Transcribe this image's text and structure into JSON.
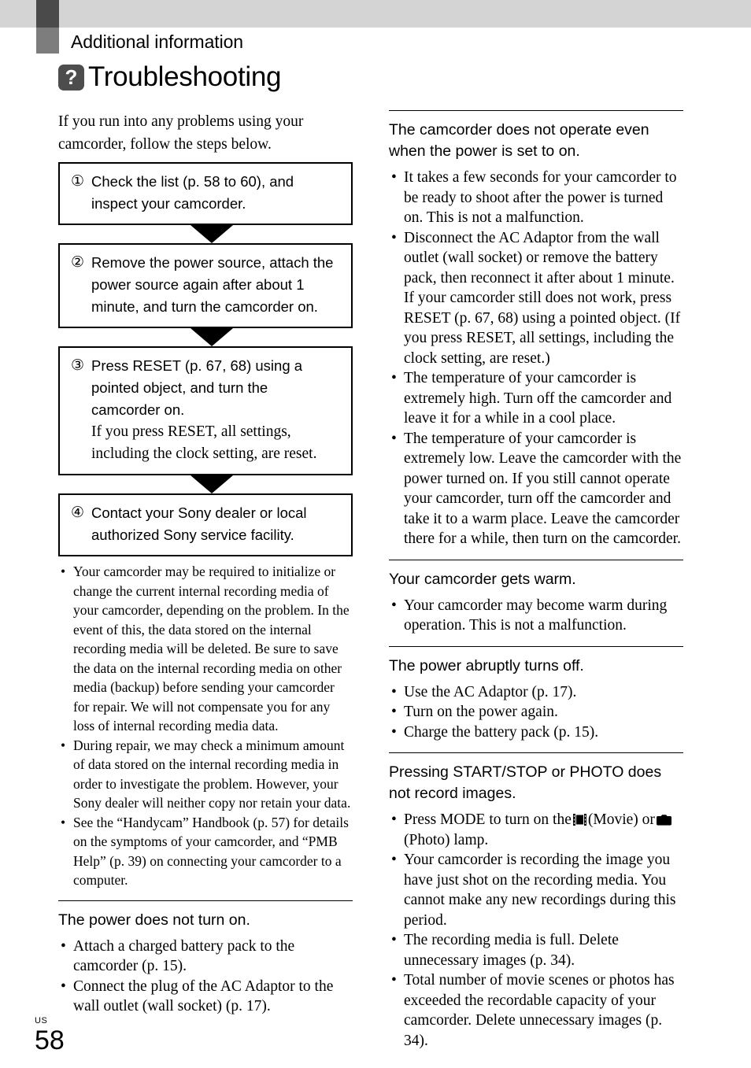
{
  "header": {
    "chapter": "Additional information",
    "section_title": "Troubleshooting",
    "badge_glyph": "?",
    "bar_color": "#d4d4d4",
    "tab_dark_color": "#4a4a4a",
    "tab_mid_color": "#7d7d7d",
    "badge_color": "#4d4d4d"
  },
  "left": {
    "intro": "If you run into any problems using your camcorder, follow the steps below.",
    "flow": [
      {
        "num": "①",
        "text": "Check the list (p. 58 to 60), and inspect your camcorder.",
        "sub": ""
      },
      {
        "num": "②",
        "text": "Remove the power source, attach the power source again after about 1 minute, and turn the camcorder on.",
        "sub": ""
      },
      {
        "num": "③",
        "text": "Press RESET (p. 67, 68) using a pointed object, and turn the camcorder on.",
        "sub": "If you press RESET, all settings, including the clock setting, are reset."
      },
      {
        "num": "④",
        "text": "Contact your Sony dealer or local authorized Sony service facility.",
        "sub": ""
      }
    ],
    "notes": [
      "Your camcorder may be required to initialize or change the current internal recording media of your camcorder, depending on the problem. In the event of this, the data stored on the internal recording media will be deleted. Be sure to save the data on the internal recording media on other media (backup) before sending your camcorder for repair. We will not compensate you for any loss of internal recording media data.",
      "During repair, we may check a minimum amount of data stored on the internal recording media in order to investigate the problem. However, your Sony dealer will neither copy nor retain your data.",
      "See the “Handycam” Handbook (p. 57) for details on the symptoms of your camcorder, and “PMB Help” (p. 39) on connecting your camcorder to a computer."
    ],
    "section": {
      "heading": "The power does not turn on.",
      "items": [
        "Attach a charged battery pack to the camcorder (p. 15).",
        "Connect the plug of the AC Adaptor to the wall outlet (wall socket) (p. 17)."
      ]
    }
  },
  "right": {
    "sections": [
      {
        "heading": "The camcorder does not operate even when the power is set to on.",
        "items": [
          "It takes a few seconds for your camcorder to be ready to shoot after the power is turned on. This is not a malfunction.",
          "Disconnect the AC Adaptor from the wall outlet (wall socket) or remove the battery pack, then reconnect it after about 1 minute. If your camcorder still does not work, press RESET (p. 67, 68) using a pointed object. (If you press RESET, all settings, including the clock setting, are reset.)",
          "The temperature of your camcorder is extremely high. Turn off the camcorder and leave it for a while in a cool place.",
          "The temperature of your camcorder is extremely low. Leave the camcorder with the power turned on. If you still cannot operate your camcorder, turn off the camcorder and take it to a warm place. Leave the camcorder there for a while, then turn on the camcorder."
        ]
      },
      {
        "heading": "Your camcorder gets warm.",
        "items": [
          "Your camcorder may become warm during operation. This is not a malfunction."
        ]
      },
      {
        "heading": "The power abruptly turns off.",
        "items": [
          "Use the AC Adaptor (p. 17).",
          "Turn on the power again.",
          "Charge the battery pack (p. 15)."
        ]
      },
      {
        "heading": "Pressing START/STOP or PHOTO does not record images.",
        "items": [
          "Your camcorder is recording the image you have just shot on the recording media. You cannot make any new recordings during this period.",
          "The recording media is full. Delete unnecessary images (p. 34).",
          "Total number of movie scenes or photos has exceeded the recordable capacity of your camcorder. Delete unnecessary images (p. 34)."
        ],
        "mode_item": {
          "before": "Press MODE to turn on the",
          "middle": "(Movie) or",
          "after": "(Photo) lamp.",
          "movie_icon": "movie-film-icon",
          "photo_icon": "photo-camera-icon"
        }
      }
    ]
  },
  "footer": {
    "locale": "US",
    "page": "58"
  }
}
